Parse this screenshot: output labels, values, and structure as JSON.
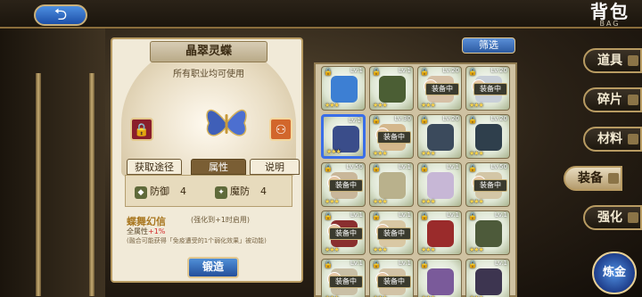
{
  "header": {
    "back_icon": "back-arrow-icon",
    "title": "背包",
    "subtitle": "BAG"
  },
  "detail": {
    "item_name": "晶翠灵蝶",
    "usage": "所有职业均可使用",
    "tabs": [
      "获取途径",
      "属性",
      "说明"
    ],
    "stats": {
      "def_label": "防御",
      "def_value": "4",
      "mdef_label": "魔防",
      "mdef_value": "4"
    },
    "skill": {
      "name": "蝶舞幻信",
      "requirement": "(强化到+1时启用)",
      "line1_prefix": "全属性",
      "line1_value": "+1%",
      "line2": "(融合可能获得「免疫遭受的1个弱化效果」被动能)"
    },
    "forge_label": "锻造"
  },
  "grid": {
    "filter_label": "筛选",
    "equipped_label": "装备中",
    "slots": [
      {
        "lv": "Lv.1",
        "locked": true,
        "equipped": false,
        "color": "#3d7fd3",
        "selected": false
      },
      {
        "lv": "Lv.1",
        "locked": true,
        "equipped": false,
        "color": "#4b5e34",
        "selected": false
      },
      {
        "lv": "Lv.20",
        "locked": true,
        "equipped": true,
        "color": "#d6c0a6",
        "selected": false
      },
      {
        "lv": "Lv.20",
        "locked": true,
        "equipped": true,
        "color": "#c8cfd8",
        "selected": false
      },
      {
        "lv": "Lv.1",
        "locked": false,
        "equipped": false,
        "color": "#3a4d8a",
        "selected": true
      },
      {
        "lv": "Lv.30",
        "locked": true,
        "equipped": true,
        "color": "#d4b78c",
        "selected": false
      },
      {
        "lv": "Lv.20",
        "locked": true,
        "equipped": false,
        "color": "#3b4a5c",
        "selected": false
      },
      {
        "lv": "Lv.20",
        "locked": true,
        "equipped": false,
        "color": "#2f3f4c",
        "selected": false
      },
      {
        "lv": "Lv.50",
        "locked": true,
        "equipped": true,
        "color": "#c9b79a",
        "selected": false
      },
      {
        "lv": "Lv.1",
        "locked": true,
        "equipped": false,
        "color": "#b9b18c",
        "selected": false
      },
      {
        "lv": "Lv.1",
        "locked": true,
        "equipped": false,
        "color": "#c7b7d6",
        "selected": false
      },
      {
        "lv": "Lv.50",
        "locked": true,
        "equipped": true,
        "color": "#d3c6a6",
        "selected": false
      },
      {
        "lv": "Lv.1",
        "locked": true,
        "equipped": true,
        "color": "#8a2f2f",
        "selected": false
      },
      {
        "lv": "Lv.1",
        "locked": true,
        "equipped": true,
        "color": "#d9c8a4",
        "selected": false
      },
      {
        "lv": "Lv.1",
        "locked": true,
        "equipped": false,
        "color": "#9a2b2b",
        "selected": false
      },
      {
        "lv": "Lv.1",
        "locked": true,
        "equipped": false,
        "color": "#4d5a3a",
        "selected": false
      },
      {
        "lv": "Lv.1",
        "locked": true,
        "equipped": true,
        "color": "#c9bfa5",
        "selected": false
      },
      {
        "lv": "Lv.1",
        "locked": true,
        "equipped": true,
        "color": "#d2c3a6",
        "selected": false
      },
      {
        "lv": "",
        "locked": true,
        "equipped": false,
        "color": "#7a5a9a",
        "selected": false
      },
      {
        "lv": "Lv.1",
        "locked": true,
        "equipped": false,
        "color": "#3d3550",
        "selected": false
      }
    ]
  },
  "sidebar": {
    "items": [
      "道具",
      "碎片",
      "材料",
      "装备",
      "强化"
    ],
    "active": "装备",
    "synth_label": "炼金"
  }
}
